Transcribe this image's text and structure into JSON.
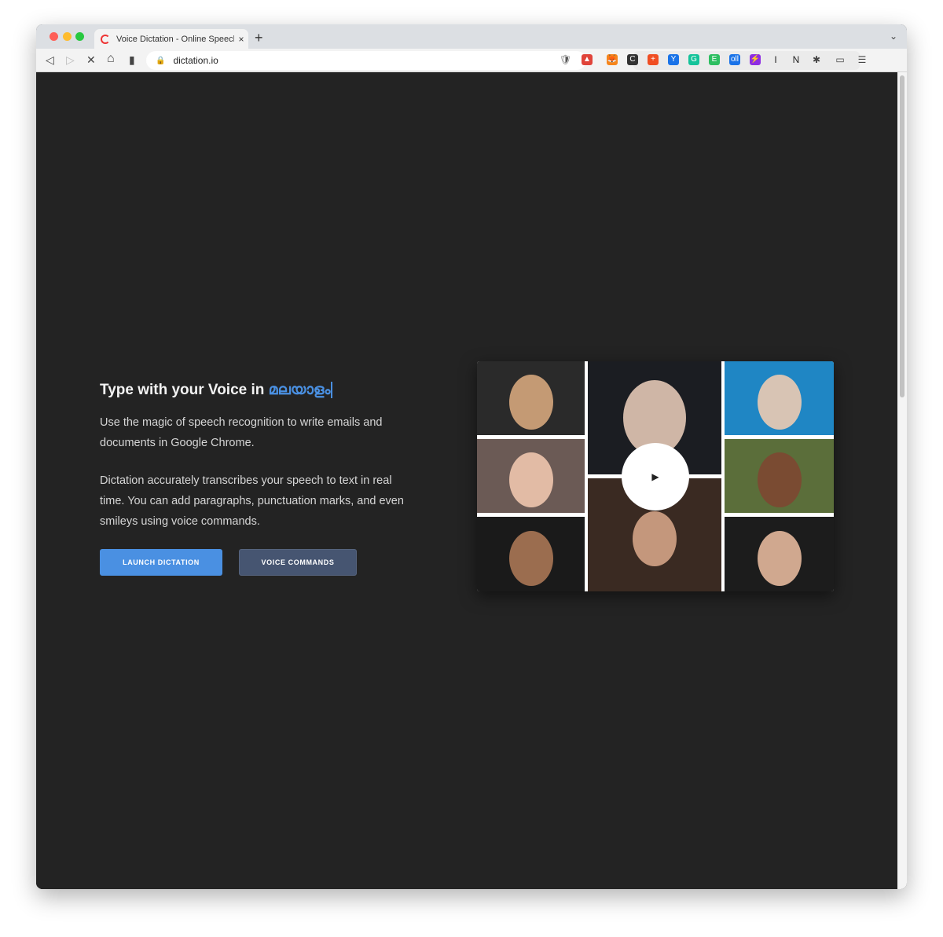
{
  "browser": {
    "tab_title": "Voice Dictation - Online Speech",
    "tab_close": "×",
    "new_tab": "+",
    "tab_menu": "⌄",
    "url": "dictation.io",
    "nav": {
      "back": "◁",
      "forward": "▷",
      "stop": "✕",
      "home": "⌂",
      "bookmark": "▮"
    },
    "extensions": [
      {
        "name": "brave-shields-icon",
        "glyph": "🛡",
        "color": "#555555"
      },
      {
        "name": "brave-rewards-icon",
        "glyph": "▲",
        "color": "#e0443a"
      },
      {
        "name": "metamask-icon",
        "glyph": "🦊",
        "color": "#f6851b"
      },
      {
        "name": "c-extension-icon",
        "glyph": "C",
        "color": "#333333"
      },
      {
        "name": "plus-extension-icon",
        "glyph": "+",
        "color": "#f04e23"
      },
      {
        "name": "vimeo-extension-icon",
        "glyph": "Y",
        "color": "#1a73e8"
      },
      {
        "name": "grammarly-icon",
        "glyph": "G",
        "color": "#15c39a"
      },
      {
        "name": "evernote-icon",
        "glyph": "E",
        "color": "#2dbe60"
      },
      {
        "name": "otter-icon",
        "glyph": "oll",
        "color": "#1a73e8"
      },
      {
        "name": "purple-extension-icon",
        "glyph": "⚡",
        "color": "#8e2de2"
      },
      {
        "name": "i-extension-icon",
        "glyph": "I",
        "color": "#222222"
      },
      {
        "name": "notion-icon",
        "glyph": "N",
        "color": "#222222"
      },
      {
        "name": "puzzle-extensions-icon",
        "glyph": "✱",
        "color": "#444444"
      },
      {
        "name": "wallet-icon",
        "glyph": "▭",
        "color": "#444444"
      },
      {
        "name": "menu-icon",
        "glyph": "☰",
        "color": "#444444"
      }
    ]
  },
  "hero": {
    "title_prefix": "Type with your Voice in",
    "title_language": "മലയാളം",
    "paragraph1": "Use the magic of speech recognition to write emails and documents in Google Chrome.",
    "paragraph2": "Dictation accurately transcribes your speech to text in real time. You can add paragraphs, punctuation marks, and even smileys using voice commands.",
    "launch_button": "LAUNCH DICTATION",
    "commands_button": "VOICE COMMANDS",
    "play_glyph": "▶"
  },
  "colors": {
    "accent": "#4a90e2",
    "secondary_button": "#465571",
    "background": "#232323"
  }
}
